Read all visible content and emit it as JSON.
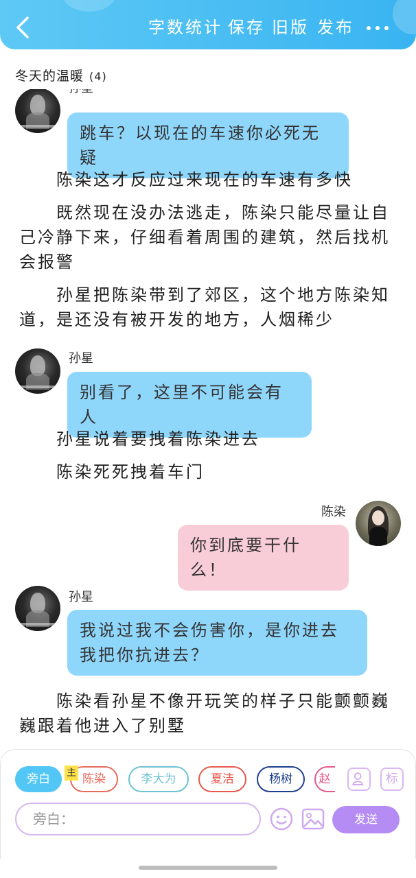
{
  "header": {
    "word_count": "字数统计",
    "save": "保存",
    "old_version": "旧版",
    "publish": "发布"
  },
  "title": {
    "name": "冬天的温暖",
    "count": "(4)"
  },
  "messages": {
    "m1_text": "跳车？以现在的车速你必死无疑",
    "speaker_top": "孙星",
    "n1": "陈染这才反应过来现在的车速有多快",
    "n2": "既然现在没办法逃走，陈染只能尽量让自己冷静下来，仔细看着周围的建筑，然后找机会报警",
    "n3": "孙星把陈染带到了郊区，这个地方陈染知道，是还没有被开发的地方，人烟稀少",
    "m2_speaker": "孙星",
    "m2_text": "别看了，这里不可能会有人",
    "n4": "孙星说着要拽着陈染进去",
    "n5": "陈染死死拽着车门",
    "m3_speaker": "陈染",
    "m3_text": "你到底要干什么！",
    "m4_speaker": "孙星",
    "m4_text": "我说过我不会伤害你，是你进去我把你抗进去？",
    "n6": "陈染看孙星不像开玩笑的样子只能颤颤巍巍跟着他进入了别墅"
  },
  "roles": {
    "owner_badge": "主",
    "chips": [
      "旁白",
      "陈染",
      "李大为",
      "夏洁",
      "杨树",
      "赵"
    ],
    "colors": [
      "#52c7f5",
      "#e86a5c",
      "#6cc1d1",
      "#e8584e",
      "#1e3f8f",
      "#e8588c"
    ]
  },
  "tools": {
    "label_icon": "标"
  },
  "input": {
    "placeholder": "旁白：",
    "send": "发送"
  }
}
